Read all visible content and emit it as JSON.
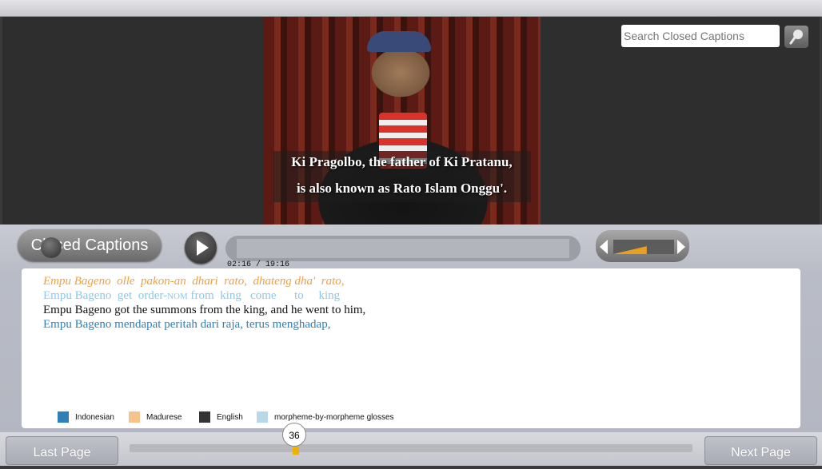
{
  "search": {
    "placeholder": "Search Closed Captions"
  },
  "video": {
    "subtitle_line1": "Ki Pragolbo, the father of Ki Pratanu,",
    "subtitle_line2": "is also known as Rato Islam Onggu'."
  },
  "controls": {
    "cc_label": "Closed Captions",
    "time": "02:16 / 19:16",
    "seek_fraction": 0.118,
    "volume_fraction": 0.55
  },
  "transcript": {
    "madurese": "Empu Bageno  olle  pakon-an  dhari  rato,  dhateng dha'  rato,",
    "gloss_prefix": "Empu Bageno  get  order-",
    "gloss_nom": "NOM",
    "gloss_suffix": " from  king   come      to     king",
    "english": "Empu Bageno got the summons from the king, and he went to him,",
    "indonesian": "Empu Bageno mendapat peritah dari raja, terus menghadap,"
  },
  "legend": [
    {
      "label": "Indonesian",
      "color": "#2f7fb8"
    },
    {
      "label": "Madurese",
      "color": "#f6c48a"
    },
    {
      "label": "English",
      "color": "#333333"
    },
    {
      "label": "morpheme-by-morpheme glosses",
      "color": "#b8d8ea"
    }
  ],
  "pagination": {
    "last_label": "Last Page",
    "next_label": "Next Page",
    "current_page": "36"
  },
  "colors": {
    "accent_orange": "#f0a040",
    "page_marker": "#f0b000"
  }
}
